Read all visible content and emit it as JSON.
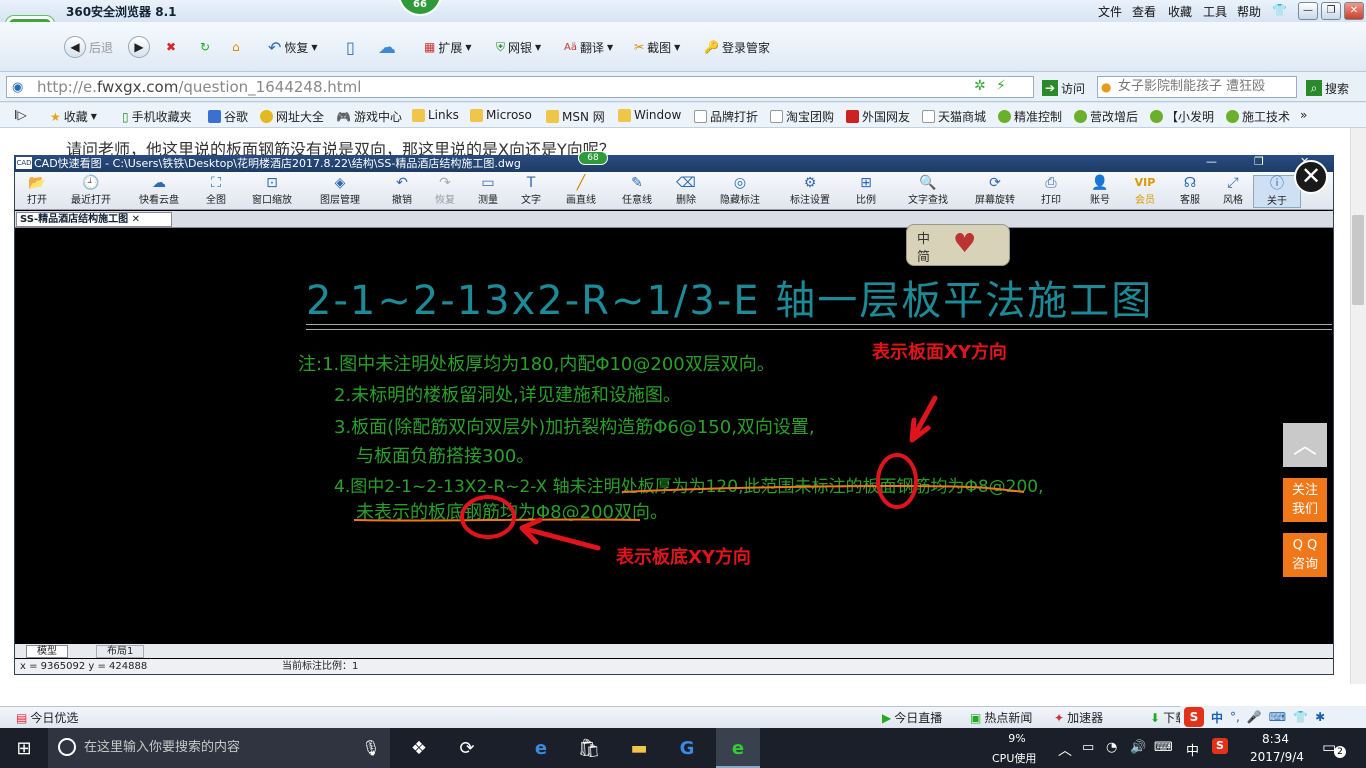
{
  "browser": {
    "title": "360安全浏览器 8.1",
    "badge": "66",
    "menu": [
      "文件",
      "查看",
      "收藏",
      "工具",
      "帮助"
    ],
    "toolbar": {
      "back": "后退",
      "restore": "恢复",
      "extend": "扩展",
      "bank": "网银",
      "translate": "翻译",
      "screenshot": "截图",
      "login": "登录管家"
    },
    "url_prefix": "http://e.",
    "url_domain": "fwxgx.com",
    "url_path": "/question_1644248.html",
    "visit": "访问",
    "search_box": "女子影院制能孩子 遭狂殴",
    "search_btn": "搜索",
    "favorites": [
      "收藏",
      "手机收藏夹",
      "谷歌",
      "网址大全",
      "游戏中心",
      "Links",
      "Microso",
      "MSN 网",
      "Window",
      "品牌打折",
      "淘宝团购",
      "外国网友",
      "天猫商城",
      "精准控制",
      "营改增后",
      "【小发明",
      "施工技术"
    ]
  },
  "page": {
    "question": "请问老师，他这里说的板面钢筋没有说是双向，那这里说的是X向还是Y向呢？",
    "float_top": "︿",
    "float_follow": "关注\n我们",
    "float_qq": "Q Q\n咨询"
  },
  "cad": {
    "window_title": "CAD快速看图 - C:\\Users\\铁铁\\Desktop\\花明楼酒店2017.8.22\\结构\\SS-精品酒店结构施工图.dwg",
    "badge": "68",
    "tools": [
      "打开",
      "最近打开",
      "快看云盘",
      "全图",
      "窗口缩放",
      "图层管理",
      "撤销",
      "恢复",
      "测量",
      "文字",
      "画直线",
      "任意线",
      "删除",
      "隐藏标注",
      "标注设置",
      "比例",
      "文字查找",
      "屏幕旋转",
      "打印",
      "账号",
      "会员",
      "客服",
      "风格",
      "关于"
    ],
    "doc_tab": "SS-精品酒店结构施工图",
    "ime": {
      "a": "中",
      "b": "简"
    },
    "drawing_title": "2-1~2-13x2-R~1/3-E 轴一层板平法施工图",
    "notes": [
      "注:1.图中未注明处板厚均为180,内配Φ10@200双层双向。",
      "2.未标明的楼板留洞处,详见建施和设施图。",
      "3.板面(除配筋双向双层外)加抗裂构造筋Φ6@150,双向设置,",
      "与板面负筋搭接300。",
      "4.图中2-1~2-13X2-R~2-X 轴未注明处板厚为为120,此范围未标注的板面钢筋均为Φ8@200,",
      "未表示的板底钢筋均为Φ8@200双向。"
    ],
    "annot_top": "表示板面XY方向",
    "annot_bottom": "表示板底XY方向",
    "model_tabs": [
      "模型",
      "布局1"
    ],
    "coords": "x = 9365092  y = 424888",
    "scale": "当前标注比例：1"
  },
  "statusbar": {
    "left": "今日优选",
    "live": "今日直播",
    "news": "热点新闻",
    "speed": "加速器",
    "download": "下载"
  },
  "taskbar": {
    "search": "在这里输入你要搜索的内容",
    "cpu_pct": "9%",
    "cpu_label": "CPU使用",
    "ime": "中",
    "time": "8:34",
    "date": "2017/9/4",
    "notif": "2"
  },
  "colors": {
    "accent": "#2d6ab5",
    "drawing_cyan": "#1d8a98",
    "note_green": "#2aa02a",
    "annot_red": "#e0141c",
    "float_orange": "#f07818"
  }
}
